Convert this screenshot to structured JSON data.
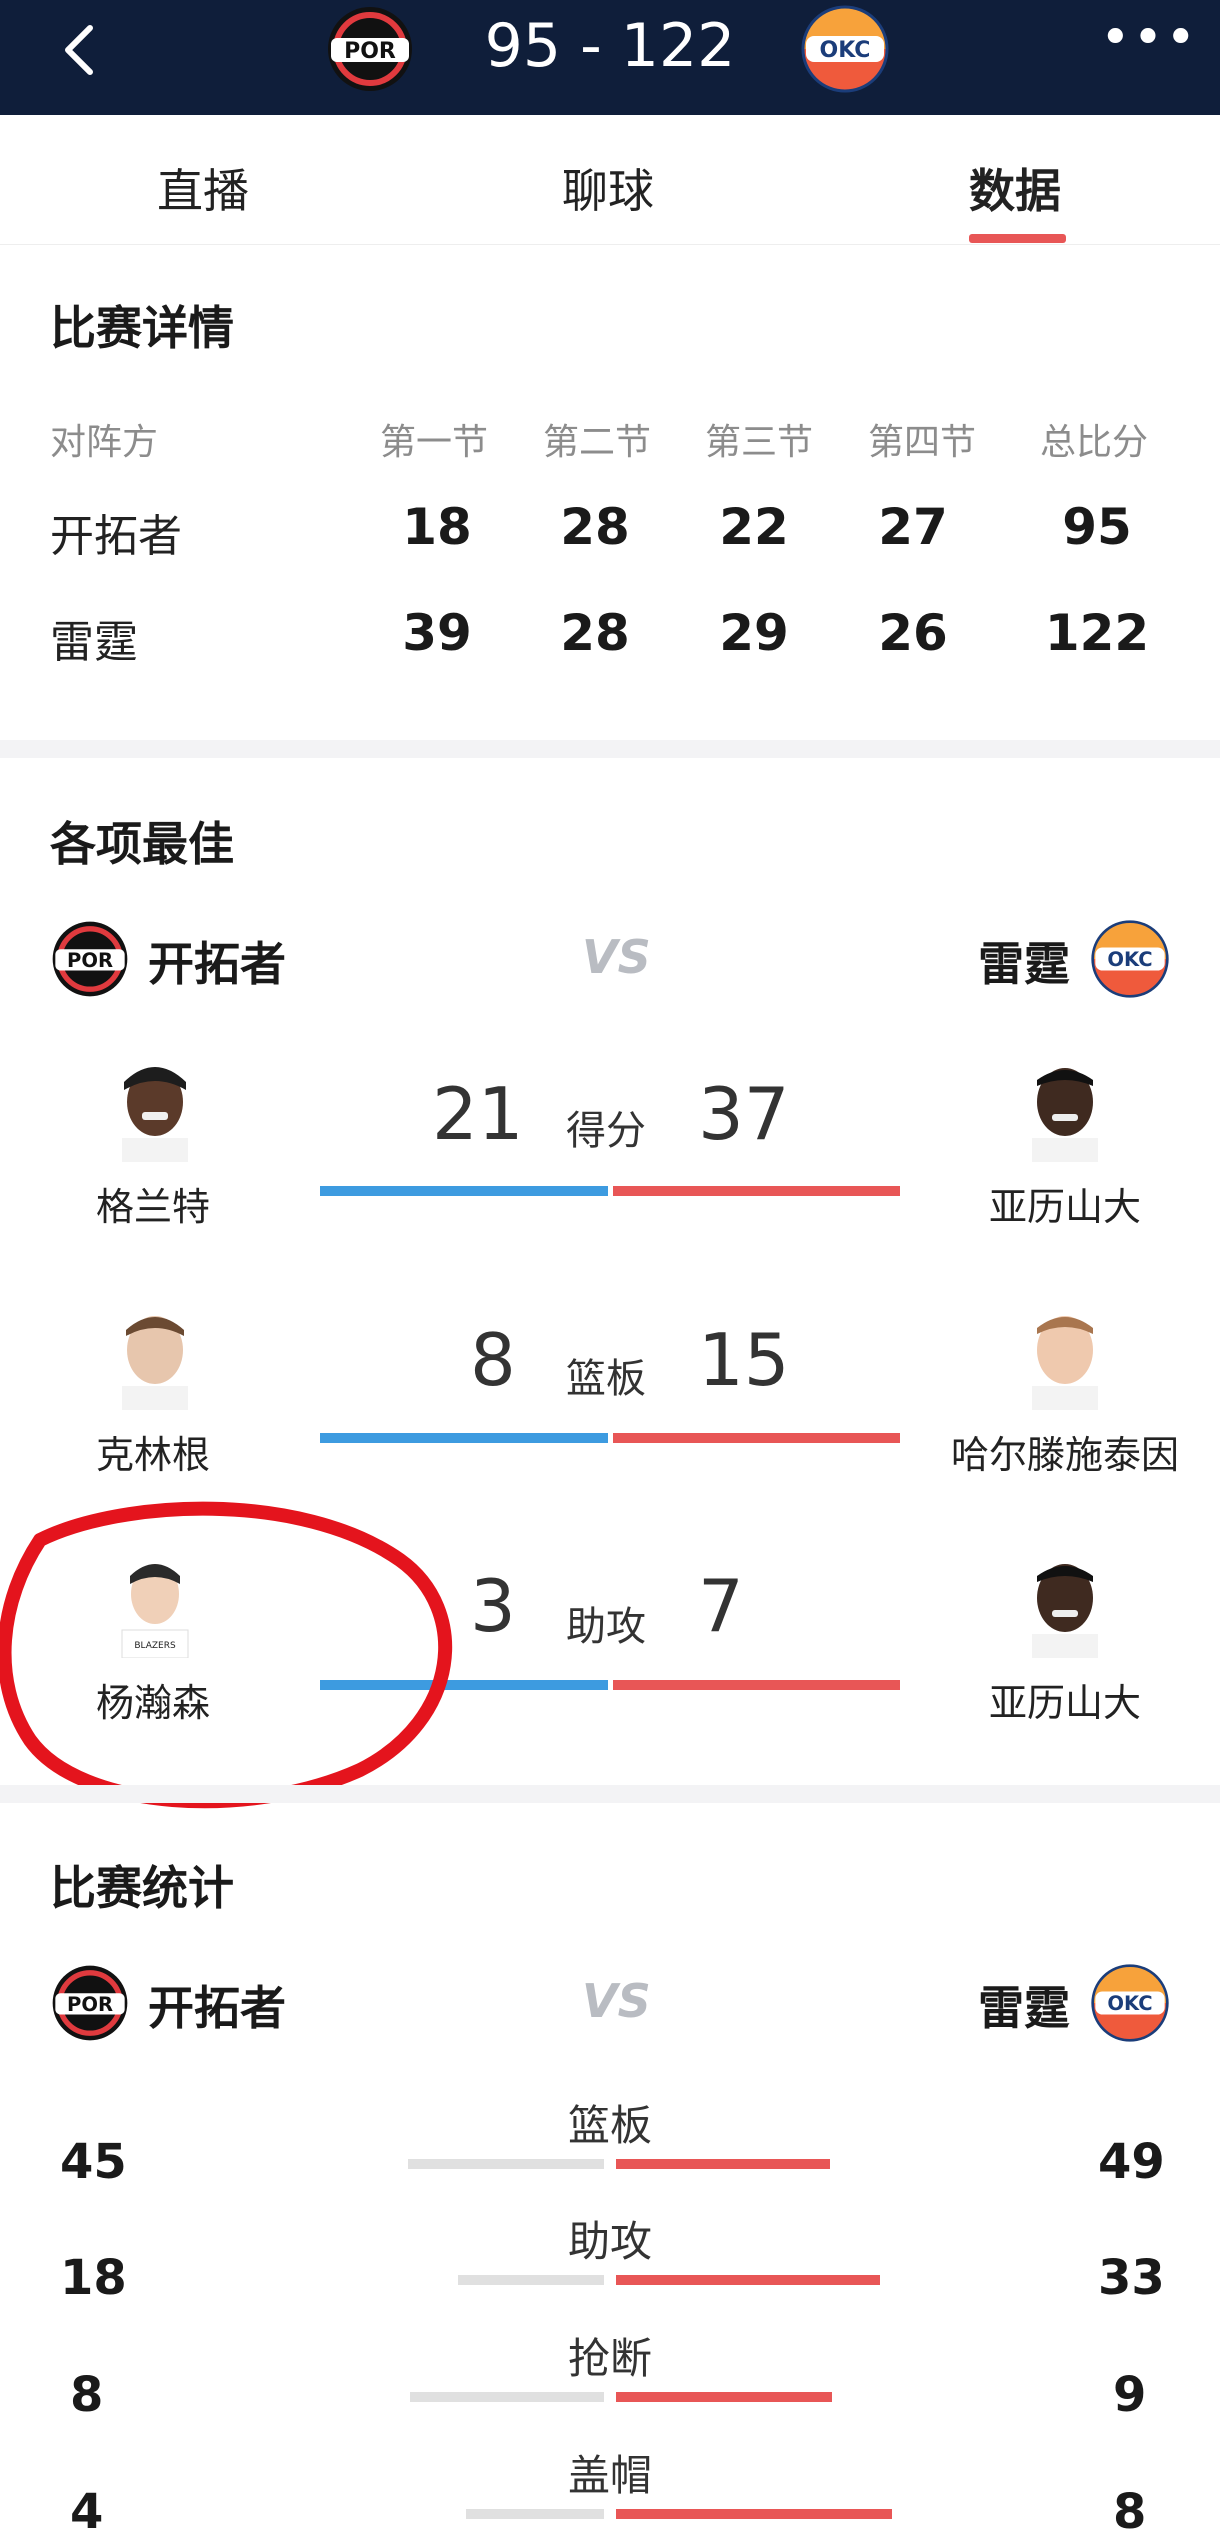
{
  "header": {
    "score": "95 - 122",
    "home_logo": "POR",
    "away_logo": "OKC",
    "more_icon": "more-icon",
    "back_icon": "back-icon"
  },
  "tabs": [
    {
      "label": "直播"
    },
    {
      "label": "聊球"
    },
    {
      "label": "数据"
    }
  ],
  "match_detail": {
    "title": "比赛详情",
    "headers": [
      "对阵方",
      "第一节",
      "第二节",
      "第三节",
      "第四节",
      "总比分"
    ],
    "rows": [
      {
        "team": "开拓者",
        "scores": [
          "18",
          "28",
          "22",
          "27",
          "95"
        ]
      },
      {
        "team": "雷霆",
        "scores": [
          "39",
          "28",
          "29",
          "26",
          "122"
        ]
      }
    ]
  },
  "best": {
    "title": "各项最佳",
    "home_team": "开拓者",
    "away_team": "雷霆",
    "vs": "VS",
    "items": [
      {
        "label": "得分",
        "home_player": "格兰特",
        "home_value": "21",
        "away_value": "37",
        "away_player": "亚历山大"
      },
      {
        "label": "篮板",
        "home_player": "克林根",
        "home_value": "8",
        "away_value": "15",
        "away_player": "哈尔滕施泰因"
      },
      {
        "label": "助攻",
        "home_player": "杨瀚森",
        "home_value": "3",
        "away_value": "7",
        "away_player": "亚历山大"
      }
    ]
  },
  "game_stats": {
    "title": "比赛统计",
    "home_team": "开拓者",
    "away_team": "雷霆",
    "vs": "VS",
    "rows": [
      {
        "label": "篮板",
        "home": "45",
        "away": "49"
      },
      {
        "label": "助攻",
        "home": "18",
        "away": "33"
      },
      {
        "label": "抢断",
        "home": "8",
        "away": "9"
      },
      {
        "label": "盖帽",
        "home": "4",
        "away": "8"
      }
    ]
  },
  "colors": {
    "header_bg": "#0f1e3a",
    "accent_red": "#e85656",
    "accent_blue": "#3d9be0"
  }
}
